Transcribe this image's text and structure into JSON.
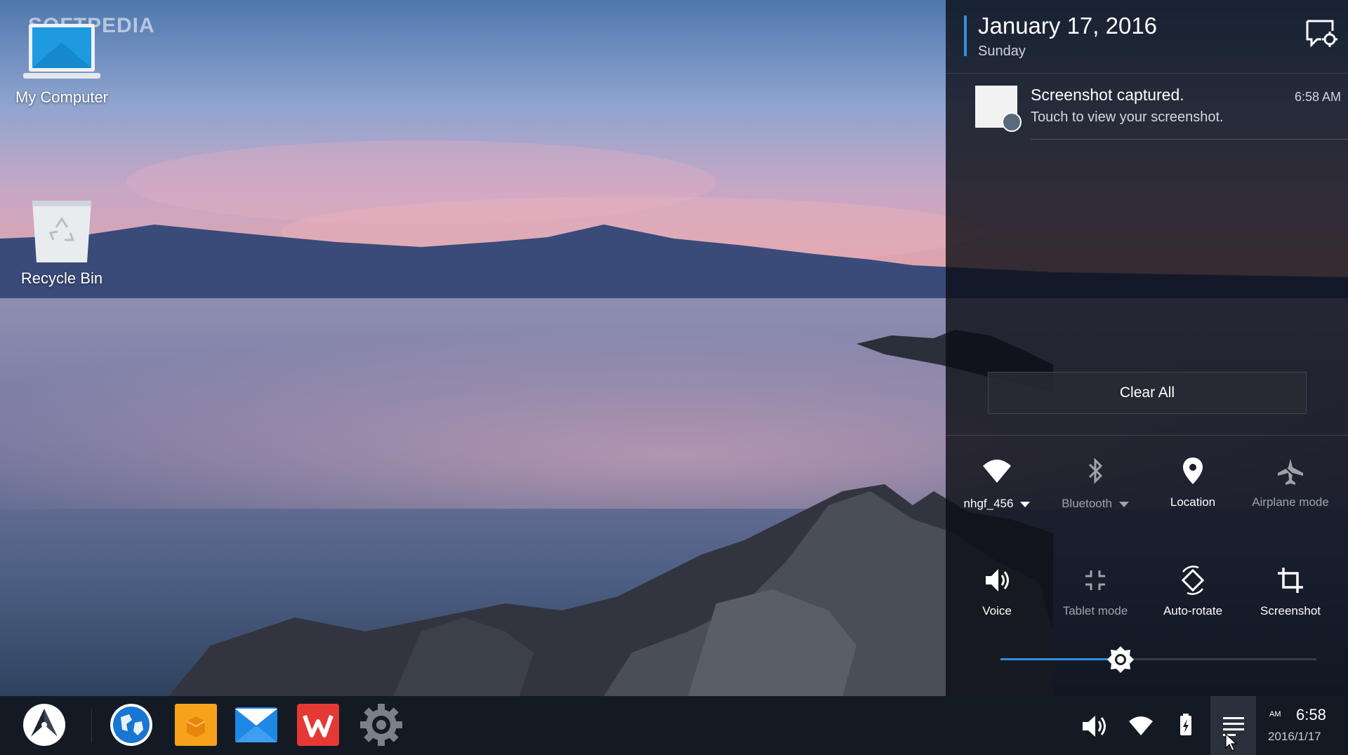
{
  "watermark": "SOFTPEDIA",
  "desktop": {
    "icons": [
      {
        "label": "My Computer",
        "icon": "laptop-icon"
      },
      {
        "label": "Recycle Bin",
        "icon": "recycle-bin-icon"
      }
    ]
  },
  "panel": {
    "date": "January 17, 2016",
    "day": "Sunday",
    "settings_icon": "notification-settings-icon",
    "accent": "#2f8fe0",
    "notification": {
      "title": "Screenshot captured.",
      "body": "Touch to view your screenshot.",
      "time": "6:58 AM"
    },
    "clear_all": "Clear All",
    "tiles": [
      {
        "label": "nhgf_456",
        "icon": "wifi-icon",
        "active": true,
        "dropdown": true
      },
      {
        "label": "Bluetooth",
        "icon": "bluetooth-icon",
        "active": false,
        "dropdown": true
      },
      {
        "label": "Location",
        "icon": "location-pin-icon",
        "active": true,
        "dropdown": false
      },
      {
        "label": "Airplane mode",
        "icon": "airplane-icon",
        "active": false,
        "dropdown": false
      },
      {
        "label": "Voice",
        "icon": "speaker-icon",
        "active": true,
        "dropdown": false
      },
      {
        "label": "Tablet mode",
        "icon": "tablet-mode-icon",
        "active": false,
        "dropdown": false
      },
      {
        "label": "Auto-rotate",
        "icon": "auto-rotate-icon",
        "active": true,
        "dropdown": false
      },
      {
        "label": "Screenshot",
        "icon": "crop-icon",
        "active": true,
        "dropdown": false
      }
    ],
    "brightness": 0.38
  },
  "taskbar": {
    "apps": [
      "start-menu-icon",
      "browser-globe-icon",
      "file-manager-icon",
      "email-icon",
      "wps-office-icon",
      "settings-gear-icon"
    ],
    "tray": [
      "volume-icon",
      "wifi-icon",
      "battery-icon",
      "notification-center-icon"
    ],
    "clock": {
      "ampm": "AM",
      "time": "6:58",
      "date": "2016/1/17"
    }
  }
}
